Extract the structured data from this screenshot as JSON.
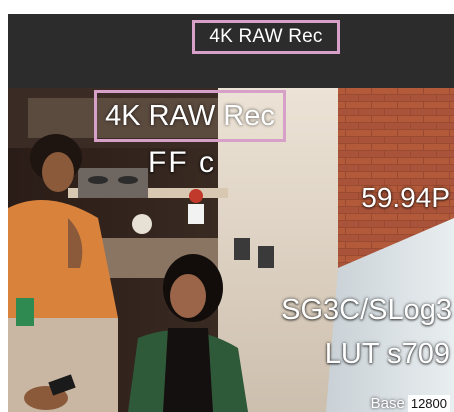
{
  "top_indicator": {
    "label": "4K RAW Rec"
  },
  "viewfinder": {
    "rec_format": "4K RAW Rec",
    "sensor_mode": "FF c",
    "frame_rate": "59.94P",
    "gamma": "SG3C/SLog3",
    "lut": "LUT s709",
    "iso": {
      "label": "Base",
      "value": "12800"
    }
  },
  "colors": {
    "highlight_border": "#d7a0c8",
    "bar_background": "#2c2c2c"
  }
}
